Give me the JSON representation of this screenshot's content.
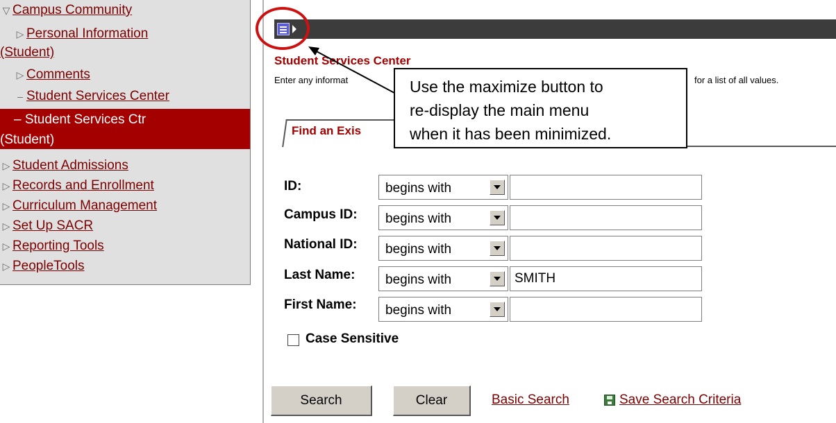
{
  "nav": {
    "campus_community": "Campus Community",
    "personal_info_line1": "Personal Information",
    "personal_info_line2": "(Student)",
    "comments": "Comments",
    "student_services_center": "Student Services Center",
    "selected_line1": "Student Services Ctr",
    "selected_line2": "(Student)",
    "student_admissions": "Student Admissions",
    "records_enrollment": "Records and Enrollment",
    "curriculum_management": "Curriculum Management",
    "set_up_sacr": "Set Up SACR",
    "reporting_tools": "Reporting Tools",
    "peopletools": "PeopleTools",
    "expanded_glyph": "▽",
    "collapsed_glyph": "▷",
    "dash_glyph": "–"
  },
  "page": {
    "title": "Student Services Center",
    "instructions_start": "Enter any informat",
    "instructions_end": "for a list of all values.",
    "tab_label": "Find an Exis"
  },
  "search": {
    "rows": [
      {
        "label": "ID:",
        "operator": "begins with",
        "value": ""
      },
      {
        "label": "Campus ID:",
        "operator": "begins with",
        "value": ""
      },
      {
        "label": "National ID:",
        "operator": "begins with",
        "value": ""
      },
      {
        "label": "Last Name:",
        "operator": "begins with",
        "value": "SMITH"
      },
      {
        "label": "First Name:",
        "operator": "begins with",
        "value": ""
      }
    ],
    "case_sensitive_label": "Case Sensitive"
  },
  "buttons": {
    "search": "Search",
    "clear": "Clear",
    "basic_search": "Basic Search",
    "save_search_criteria": "Save Search Criteria"
  },
  "callout": {
    "line1": "Use the maximize button to",
    "line2": "re-display the main menu",
    "line3": "when it has been minimized."
  },
  "colors": {
    "accent": "#a50000",
    "link": "#7b0000",
    "toolbar": "#3c3c3c",
    "highlight": "#cc1111"
  },
  "icons": [
    "maximize-icon",
    "save-icon",
    "dropdown-arrow-icon"
  ]
}
